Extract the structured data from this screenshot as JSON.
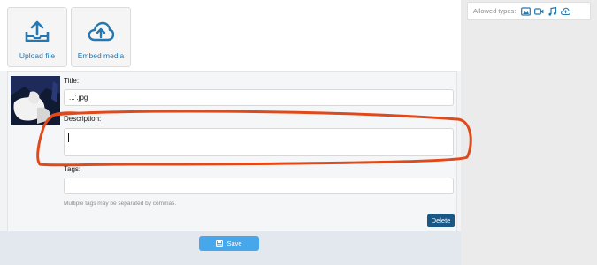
{
  "upload": {
    "upload_label": "Upload file",
    "embed_label": "Embed media",
    "upload_icon": "upload-tray-icon",
    "embed_icon": "cloud-upload-icon"
  },
  "allowed_types": {
    "label": "Allowed types:",
    "icons": [
      "image-icon",
      "video-icon",
      "audio-icon",
      "embed-icon"
    ]
  },
  "item": {
    "title_label": "Title:",
    "title_value": "...’.jpg",
    "description_label": "Description:",
    "description_value": "",
    "tags_label": "Tags:",
    "tags_value": "",
    "tags_hint": "Multiple tags may be separated by commas.",
    "delete_label": "Delete"
  },
  "footer": {
    "save_label": "Save"
  },
  "colors": {
    "accent": "#2577b1",
    "primary_button": "#185886",
    "save_button": "#47a7eb",
    "annotation": "#e0491a"
  }
}
